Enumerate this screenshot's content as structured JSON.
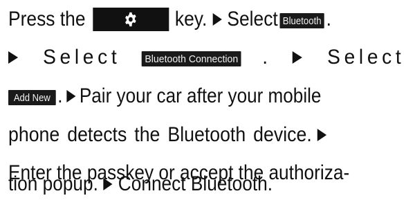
{
  "instructions": {
    "line1": {
      "press": "Press the",
      "key_icon": "gear-icon",
      "key_word": "key.",
      "select": "Select",
      "bluetooth_button": "Bluetooth",
      "end": "."
    },
    "line2": {
      "select1": "Select",
      "bt_connection_button": "Bluetooth Connection",
      "period": ".",
      "select2": "Select"
    },
    "line3": {
      "add_new_button": "Add New",
      "period": ".",
      "text": "Pair your car after your mobile"
    },
    "line4": {
      "text": "phone detects the Bluetooth device."
    },
    "line5": {
      "text": "Enter the passkey or accept the authoriza-"
    },
    "line6": {
      "text": "tion popup.",
      "connect": "Connect Bluetooth."
    }
  },
  "colors": {
    "text": "#111111",
    "button_bg": "#1a1a1a",
    "button_text": "#f2f2f2"
  }
}
